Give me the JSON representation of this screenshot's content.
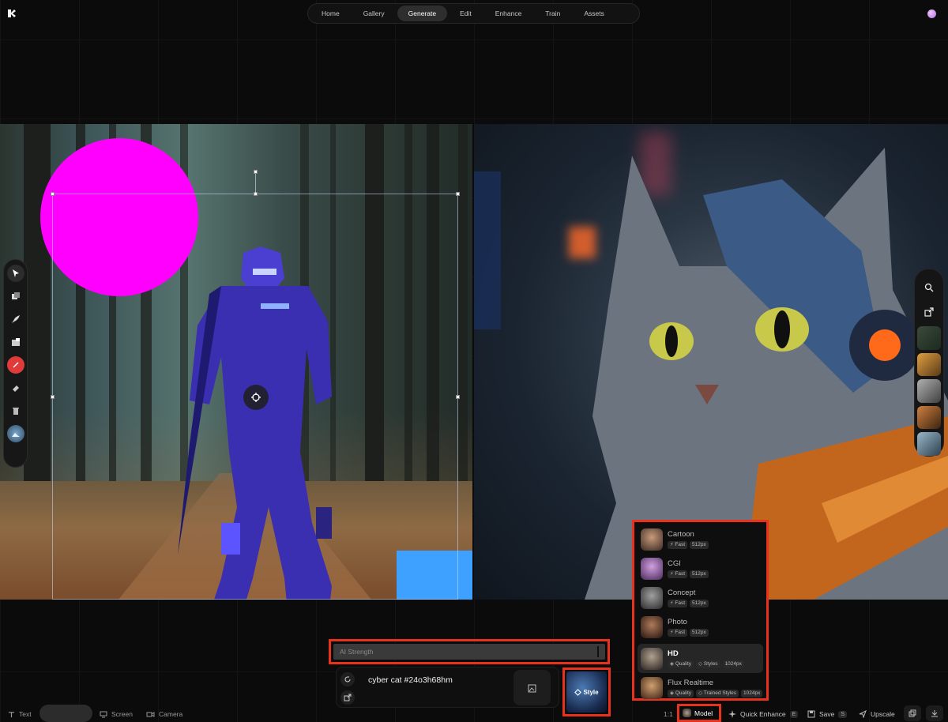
{
  "nav": {
    "tabs": [
      {
        "label": "Home"
      },
      {
        "label": "Gallery"
      },
      {
        "label": "Generate"
      },
      {
        "label": "Edit"
      },
      {
        "label": "Enhance"
      },
      {
        "label": "Train"
      },
      {
        "label": "Assets"
      }
    ],
    "active_tab": "Generate"
  },
  "colors": {
    "accent_highlight": "#e8321e",
    "magenta_shape": "#ff00ff",
    "blue_shape": "#3ea0ff"
  },
  "left_tools": [
    "select-icon",
    "layers-icon",
    "brush-icon",
    "image-add-icon",
    "color-icon",
    "eraser-icon",
    "trash-icon",
    "reference-image-icon"
  ],
  "right_rail": [
    "search-icon",
    "share-icon",
    "thumbnail",
    "thumbnail",
    "thumbnail",
    "thumbnail",
    "thumbnail"
  ],
  "models": [
    {
      "name": "Cartoon",
      "tags": [
        "Fast",
        "512px"
      ]
    },
    {
      "name": "CGI",
      "tags": [
        "Fast",
        "512px"
      ]
    },
    {
      "name": "Concept",
      "tags": [
        "Fast",
        "512px"
      ]
    },
    {
      "name": "Photo",
      "tags": [
        "Fast",
        "512px"
      ]
    },
    {
      "name": "HD",
      "tags": [
        "Quality",
        "Styles",
        "1024px"
      ]
    },
    {
      "name": "Flux Realtime",
      "tags": [
        "Quality",
        "Trained Styles",
        "1024px"
      ]
    }
  ],
  "selected_model": "HD",
  "ai_strength": {
    "label": "AI Strength"
  },
  "prompt": {
    "text": "cyber cat #24o3h68hm"
  },
  "style_button": {
    "label": "Style"
  },
  "bottom_bar": {
    "text_label": "Text",
    "screen_label": "Screen",
    "camera_label": "Camera",
    "ratio_label": "1:1",
    "model_label": "Model",
    "quick_enhance_label": "Quick Enhance",
    "quick_enhance_key": "E",
    "save_label": "Save",
    "save_key": "S",
    "upscale_label": "Upscale"
  }
}
